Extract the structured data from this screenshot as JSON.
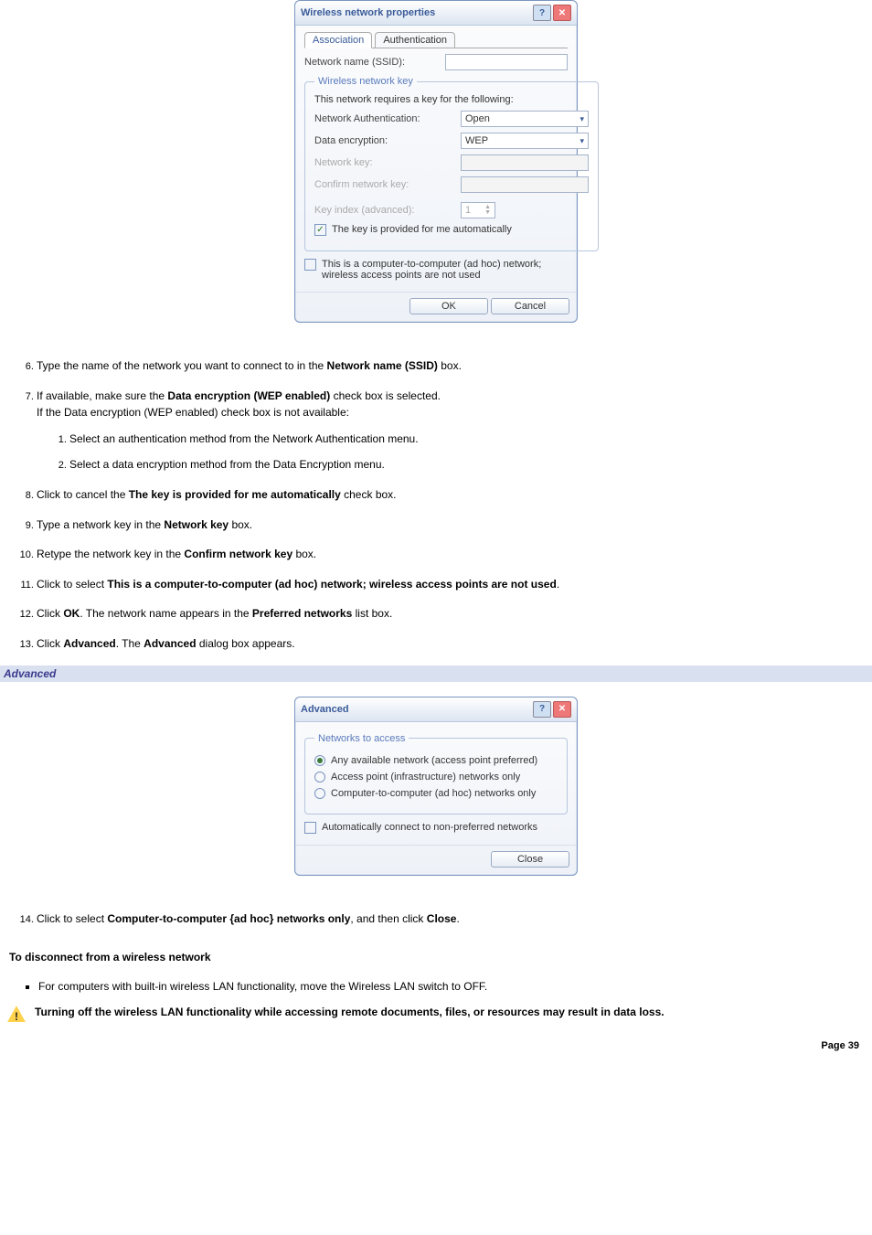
{
  "dialog1": {
    "title": "Wireless network properties",
    "tabs": {
      "assoc": "Association",
      "auth": "Authentication"
    },
    "ssid_label": "Network name (SSID):",
    "group_title": "Wireless network key",
    "requires": "This network requires a key for the following:",
    "netauth_label": "Network Authentication:",
    "netauth_value": "Open",
    "dataenc_label": "Data encryption:",
    "dataenc_value": "WEP",
    "netkey_label": "Network key:",
    "confirm_label": "Confirm network key:",
    "keyidx_label": "Key index (advanced):",
    "keyidx_value": "1",
    "autokey": "The key is provided for me automatically",
    "adhoc": "This is a computer-to-computer (ad hoc) network; wireless access points are not used",
    "ok": "OK",
    "cancel": "Cancel"
  },
  "steps": {
    "s6_a": "Type the name of the network you want to connect to in the ",
    "s6_b": "Network name (SSID)",
    "s6_c": " box.",
    "s7_a": "If available, make sure the ",
    "s7_b": "Data encryption (WEP enabled)",
    "s7_c": " check box is selected.",
    "s7_d": "If the Data encryption (WEP enabled) check box is not available:",
    "s7_1": "Select an authentication method from the Network Authentication menu.",
    "s7_2": "Select a data encryption method from the Data Encryption menu.",
    "s8_a": "Click to cancel the ",
    "s8_b": "The key is provided for me automatically",
    "s8_c": " check box.",
    "s9_a": "Type a network key in the ",
    "s9_b": "Network key",
    "s9_c": " box.",
    "s10_a": "Retype the network key in the ",
    "s10_b": "Confirm network key",
    "s10_c": " box.",
    "s11_a": "Click to select ",
    "s11_b": "This is a computer-to-computer (ad hoc) network; wireless access points are not used",
    "s11_c": ".",
    "s12_a": "Click ",
    "s12_b": "OK",
    "s12_c": ". The network name appears in the ",
    "s12_d": "Preferred networks",
    "s12_e": " list box.",
    "s13_a": "Click ",
    "s13_b": "Advanced",
    "s13_c": ". The ",
    "s13_d": "Advanced",
    "s13_e": " dialog box appears.",
    "s14_a": "Click to select ",
    "s14_b": "Computer-to-computer {ad hoc} networks only",
    "s14_c": ", and then click ",
    "s14_d": "Close",
    "s14_e": "."
  },
  "advanced_band": "Advanced",
  "dialog2": {
    "title": "Advanced",
    "group_title": "Networks to access",
    "r1": "Any available network (access point preferred)",
    "r2": "Access point (infrastructure) networks only",
    "r3": "Computer-to-computer (ad hoc) networks only",
    "autoconn": "Automatically connect to non-preferred networks",
    "close": "Close"
  },
  "disconnect_heading": "To disconnect from a wireless network",
  "disconnect_bullet": "For computers with built-in wireless LAN functionality, move the Wireless LAN switch to OFF.",
  "warning": "Turning off the wireless LAN functionality while accessing remote documents, files, or resources may result in data loss.",
  "page_label": "Page 39"
}
